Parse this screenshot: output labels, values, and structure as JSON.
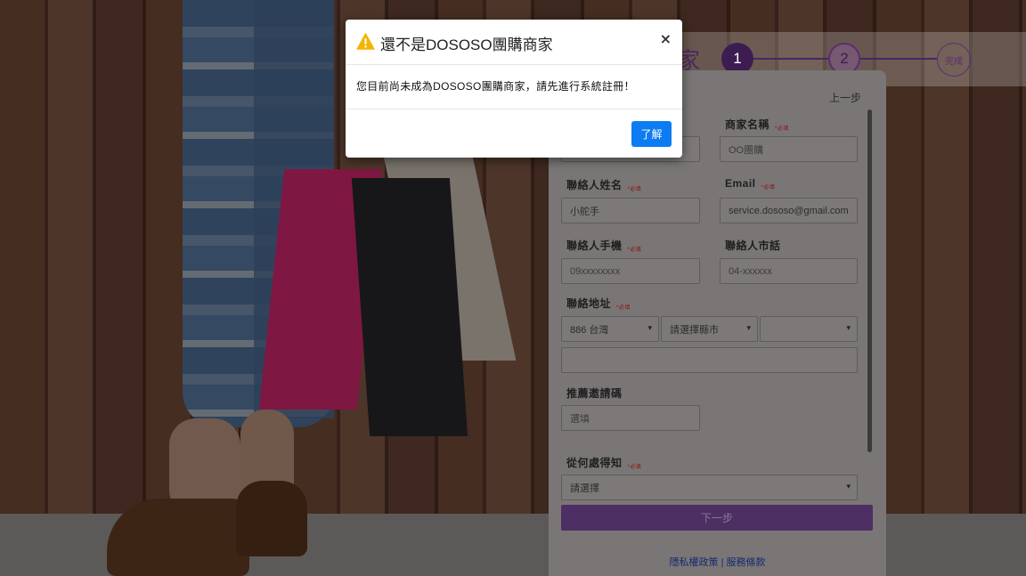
{
  "stepbar": {
    "title_fragment": "家",
    "steps": [
      "1",
      "2",
      "完成"
    ]
  },
  "form": {
    "prev_link": "上一步",
    "required_mark": "*必填",
    "fields": {
      "merchant_name": {
        "label": "商家名稱",
        "placeholder": "OO團購"
      },
      "contact_name": {
        "label": "聯絡人姓名",
        "value": "小舵手"
      },
      "email": {
        "label": "Email",
        "value": "service.dososo@gmail.com"
      },
      "mobile": {
        "label": "聯絡人手機",
        "placeholder": "09xxxxxxxx"
      },
      "phone": {
        "label": "聯絡人市話",
        "placeholder": "04-xxxxxx"
      },
      "address": {
        "label": "聯絡地址",
        "country": "886 台灣",
        "city": "請選擇縣市",
        "district": "",
        "street": ""
      },
      "referral": {
        "label": "推薦邀請碼",
        "placeholder": "選填"
      },
      "source": {
        "label": "從何處得知",
        "value": "請選擇"
      }
    },
    "next_button": "下一步",
    "footer": {
      "privacy": "隱私權政策",
      "separator": "|",
      "terms": "服務條款"
    }
  },
  "modal": {
    "icon": "warning-icon",
    "title": "還不是DOSOSO團購商家",
    "close_label": "×",
    "message": "您目前尚未成為DOSOSO團購商家，請先進行系統註冊！",
    "ok_button": "了解",
    "accent": "#0d7cf2"
  }
}
